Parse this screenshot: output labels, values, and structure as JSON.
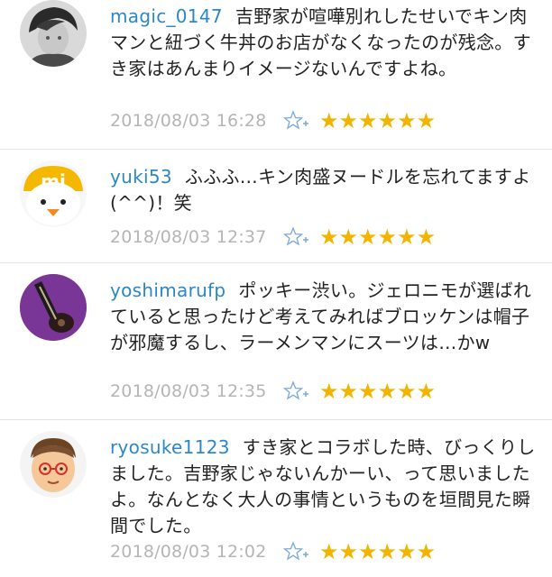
{
  "comments": [
    {
      "username": "magic_0147",
      "text": "吉野家が喧嘩別れしたせいでキン肉マンと紐づく牛丼のお店がなくなったのが残念。すき家はあんまりイメージないんですよね。",
      "timestamp": "2018/08/03 16:28",
      "stars": "★★★★★★",
      "avatar": "profile-photo"
    },
    {
      "username": "yuki53",
      "text": "ふふふ…キン肉盛ヌードルを忘れてますよ(^^)！笑",
      "timestamp": "2018/08/03 12:37",
      "stars": "★★★★★★",
      "avatar": "duck-mi-logo"
    },
    {
      "username": "yoshimarufp",
      "text": "ポッキー渋い。ジェロニモが選ばれていると思ったけど考えてみればブロッケンは帽子が邪魔するし、ラーメンマンにスーツは…かw",
      "timestamp": "2018/08/03 12:35",
      "stars": "★★★★★★",
      "avatar": "guitar-photo"
    },
    {
      "username": "ryosuke1123",
      "text": "すき家とコラボした時、びっくりしました。吉野家じゃないんかーい、って思いましたよ。なんとなく大人の事情というものを垣間見た瞬間でした。",
      "timestamp": "2018/08/03 12:02",
      "stars": "★★★★★★",
      "avatar": "cartoon-glasses-face"
    }
  ],
  "colors": {
    "username": "#2b87c8",
    "timestamp": "#b5b5b5",
    "star": "#f1b400",
    "divider": "#e4e4e4"
  },
  "icons": {
    "add_star": "star-plus-icon"
  }
}
